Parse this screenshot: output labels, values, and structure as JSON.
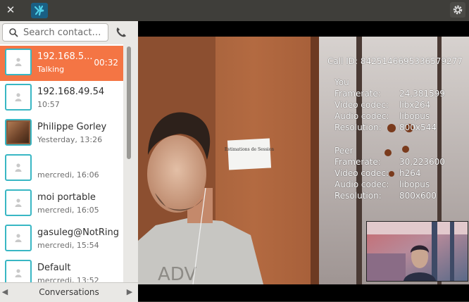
{
  "topbar": {
    "close_glyph": "✕",
    "app_icon": "ring-logo-icon",
    "settings_icon": "gear-icon"
  },
  "search": {
    "placeholder": "Search contact…",
    "value": ""
  },
  "contacts": [
    {
      "name": "192.168.5...",
      "sub": "Talking",
      "timer": "00:32",
      "active": true,
      "avatar": "person"
    },
    {
      "name": "192.168.49.54",
      "sub": "10:57",
      "avatar": "person"
    },
    {
      "name": "Philippe Gorley",
      "sub": "Yesterday, 13:26",
      "avatar": "photo"
    },
    {
      "name": "",
      "sub": "mercredi, 16:06",
      "avatar": "person"
    },
    {
      "name": "moi portable",
      "sub": "mercredi, 16:05",
      "avatar": "person"
    },
    {
      "name": "gasuleg@NotRing",
      "sub": "mercredi, 15:54",
      "avatar": "person"
    },
    {
      "name": "Default",
      "sub": "mercredi, 13:52",
      "avatar": "person"
    }
  ],
  "tabs": {
    "label": "Conversations",
    "prev": "◀",
    "next": "▶"
  },
  "call": {
    "call_id_label": "Call ID:",
    "call_id": "8425146695336579277",
    "you": {
      "title": "You",
      "framerate_label": "Framerate:",
      "framerate": "24,381599",
      "vcodec_label": "Video codec:",
      "vcodec": "libx264",
      "acodec_label": "Audio codec:",
      "acodec": "libopus",
      "res_label": "Resolution:",
      "res": "800x544"
    },
    "peer": {
      "title": "Peer",
      "framerate_label": "Framerate:",
      "framerate": "30,223600",
      "vcodec_label": "Video codec:",
      "vcodec": "h264",
      "acodec_label": "Audio codec:",
      "acodec": "libopus",
      "res_label": "Resolution:",
      "res": "800x600"
    },
    "sign_text": "Estimations de Session"
  },
  "colors": {
    "accent": "#f47544",
    "avatar_border": "#39b7c4",
    "topbar": "#3f3e3a"
  }
}
